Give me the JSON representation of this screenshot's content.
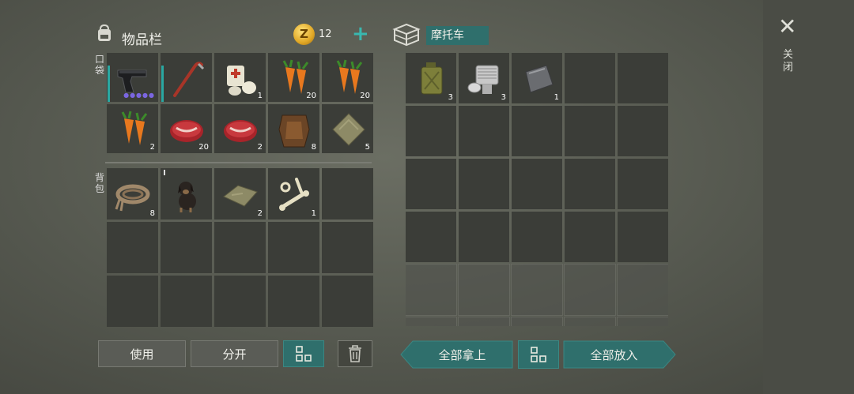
{
  "inventory": {
    "title": "物品栏",
    "coins": "12",
    "pocket_label": "口袋",
    "backpack_label": "背包",
    "pocket_slots": [
      {
        "item": "pistol",
        "count": ""
      },
      {
        "item": "crowbar",
        "count": ""
      },
      {
        "item": "bandage",
        "count": "1"
      },
      {
        "item": "carrot",
        "count": "20"
      },
      {
        "item": "carrot",
        "count": "20"
      },
      {
        "item": "carrot",
        "count": "2"
      },
      {
        "item": "raw-meat",
        "count": "20"
      },
      {
        "item": "raw-meat",
        "count": "2"
      },
      {
        "item": "leather",
        "count": "8"
      },
      {
        "item": "cloth",
        "count": "5"
      }
    ],
    "backpack_slots": [
      {
        "item": "rope",
        "count": "8"
      },
      {
        "item": "puppy",
        "count": ""
      },
      {
        "item": "cloth",
        "count": "2"
      },
      {
        "item": "bones",
        "count": "1"
      },
      {
        "item": "",
        "count": ""
      },
      {
        "item": "",
        "count": ""
      },
      {
        "item": "",
        "count": ""
      },
      {
        "item": "",
        "count": ""
      },
      {
        "item": "",
        "count": ""
      },
      {
        "item": "",
        "count": ""
      },
      {
        "item": "",
        "count": ""
      },
      {
        "item": "",
        "count": ""
      },
      {
        "item": "",
        "count": ""
      },
      {
        "item": "",
        "count": ""
      },
      {
        "item": "",
        "count": ""
      }
    ]
  },
  "container": {
    "name": "摩托车",
    "slots": [
      {
        "item": "gas-can",
        "count": "3"
      },
      {
        "item": "engine-part",
        "count": "3"
      },
      {
        "item": "metal-plate",
        "count": "1"
      }
    ]
  },
  "buttons": {
    "use": "使用",
    "split": "分开",
    "take_all": "全部拿上",
    "put_all": "全部放入"
  },
  "close_label": "关闭",
  "colors": {
    "accent": "#2f6f6c",
    "accent_light": "#39b8b0",
    "slot": "#3b3d38"
  }
}
